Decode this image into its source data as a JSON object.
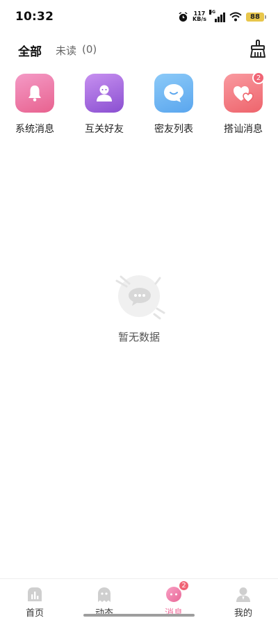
{
  "status_bar": {
    "time": "10:32",
    "net_speed_value": "117",
    "net_speed_unit": "KB/s",
    "network_type": "5G",
    "battery": "88"
  },
  "tabs": {
    "all_label": "全部",
    "unread_label": "未读",
    "unread_count": "(0)"
  },
  "categories": [
    {
      "label": "系统消息",
      "icon": "bell-icon",
      "color": "#ee7fae"
    },
    {
      "label": "互关好友",
      "icon": "person-icon",
      "color": "#a46ae0"
    },
    {
      "label": "密友列表",
      "icon": "chat-bubble-icon",
      "color": "#6fb7f5"
    },
    {
      "label": "搭讪消息",
      "icon": "hearts-icon",
      "color": "#f47b82",
      "badge": "2"
    }
  ],
  "empty_state": {
    "text": "暂无数据"
  },
  "bottom_nav": {
    "items": [
      {
        "label": "首页",
        "icon": "chart-home-icon"
      },
      {
        "label": "动态",
        "icon": "ghost-icon"
      },
      {
        "label": "消息",
        "icon": "message-icon",
        "badge": "2",
        "active": true
      },
      {
        "label": "我的",
        "icon": "profile-icon"
      }
    ]
  },
  "colors": {
    "accent": "#ef6b9a",
    "badge": "#f06575"
  }
}
